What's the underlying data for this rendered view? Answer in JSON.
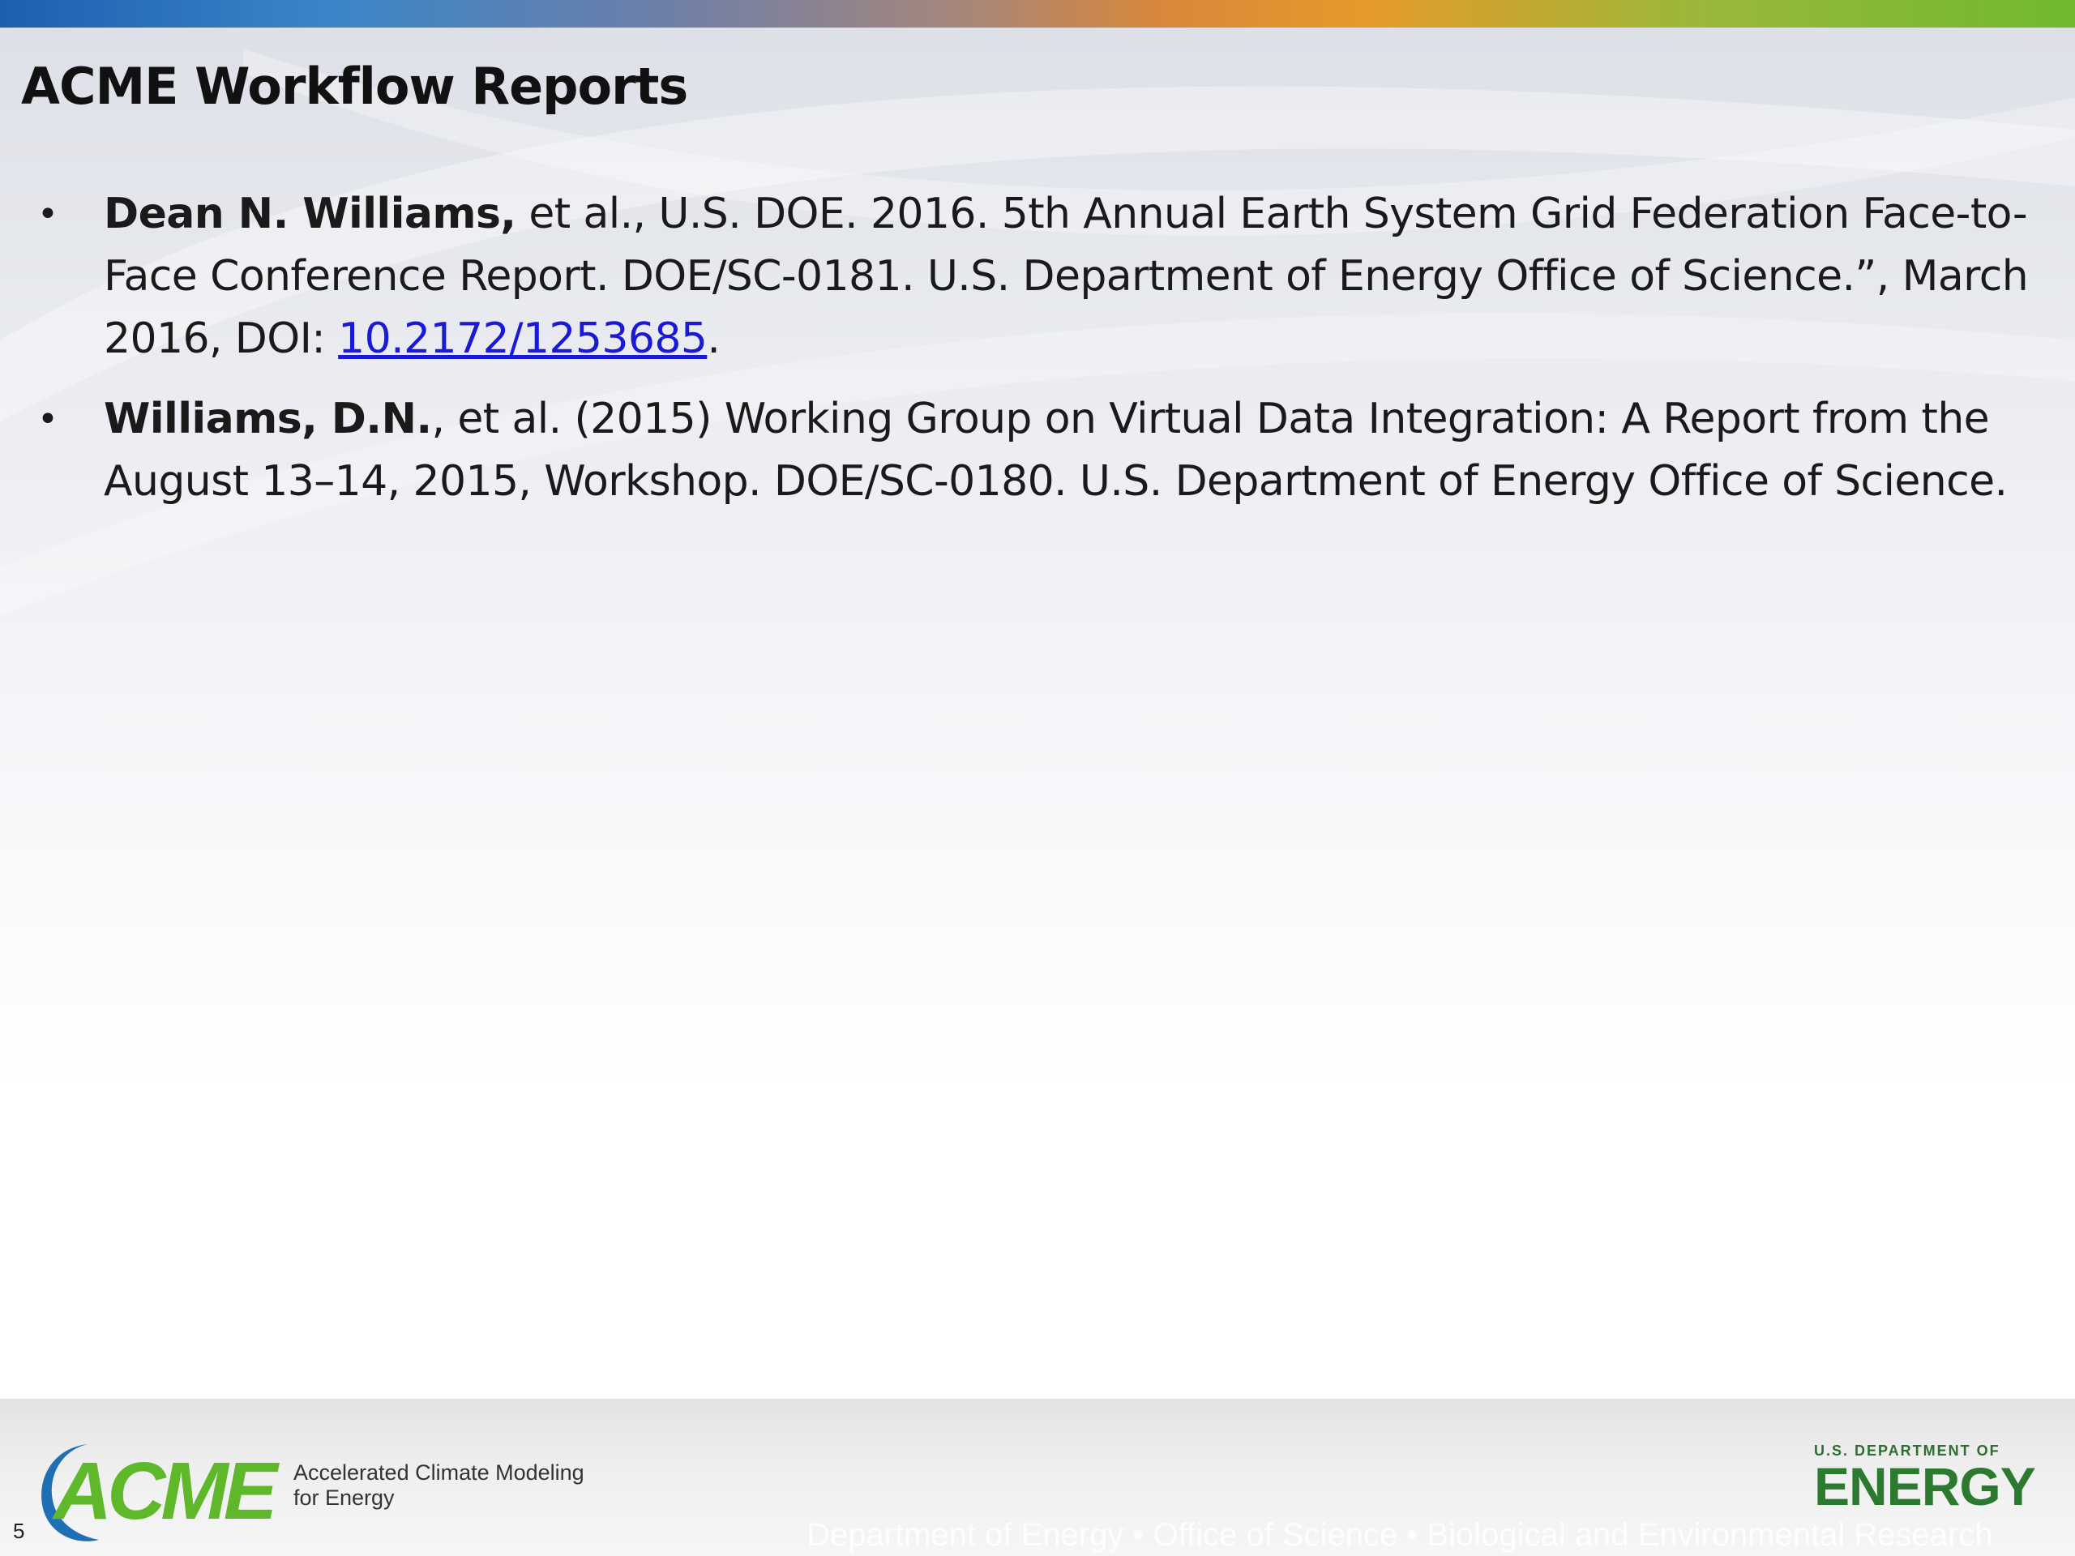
{
  "slide": {
    "title": "ACME Workflow Reports",
    "references": [
      {
        "bullet": "•",
        "author": "Dean N. Williams,",
        "text": " et al., U.S. DOE. 2016. 5th Annual Earth System Grid Federation Face-to-Face Conference Report. DOE/SC-0181. U.S. Department of Energy Office of Science.”, March 2016, DOI:  ",
        "link": "10.2172/1253685",
        "tail": "."
      },
      {
        "bullet": "•",
        "author": "Williams, D.N.",
        "text": ", et al. (2015) Working Group on Virtual Data Integration: A Report from the August 13–14, 2015, Workshop. DOE/SC-0180. U.S. Department of Energy Office of Science."
      }
    ]
  },
  "footer": {
    "acme_logo_text": "ACME",
    "acme_line1": "Accelerated Climate Modeling",
    "acme_line2": "for Energy",
    "slide_number": "5",
    "strip_text": "Department of Energy  •  Office of Science  •  Biological and Environmental Research",
    "doe_small": "U.S. DEPARTMENT OF",
    "doe_big": "ENERGY"
  },
  "colors": {
    "link": "#1a1ad6",
    "acme_green": "#5fb82a",
    "acme_blue": "#1f6fb5",
    "doe_green": "#2b7a30"
  }
}
